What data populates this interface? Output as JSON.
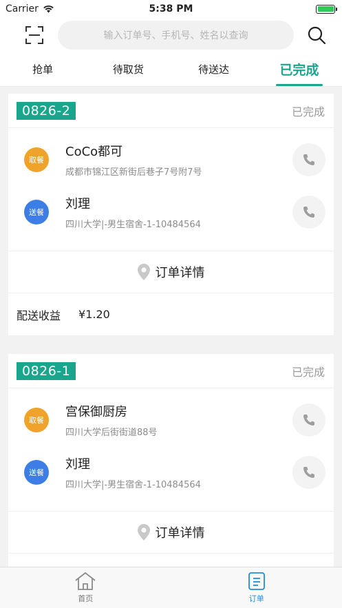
{
  "status_bar": {
    "carrier": "Carrier",
    "time": "5:38 PM"
  },
  "search": {
    "placeholder": "输入订单号、手机号、姓名以查询"
  },
  "tabs": [
    {
      "label": "抢单",
      "active": false
    },
    {
      "label": "待取货",
      "active": false
    },
    {
      "label": "待送达",
      "active": false
    },
    {
      "label": "已完成",
      "active": true
    }
  ],
  "orders": [
    {
      "order_no": "0826-2",
      "status": "已完成",
      "pickup": {
        "badge": "取餐",
        "name": "CoCo都可",
        "address": "成都市锦江区新街后巷子7号附7号"
      },
      "delivery": {
        "badge": "送餐",
        "name": "刘理",
        "address": "四川大学|-男生宿舍-1-10484564"
      },
      "detail_label": "订单详情",
      "income_label": "配送收益",
      "income_value": "¥1.20"
    },
    {
      "order_no": "0826-1",
      "status": "已完成",
      "pickup": {
        "badge": "取餐",
        "name": "宫保御厨房",
        "address": "四川大学后街街道88号"
      },
      "delivery": {
        "badge": "送餐",
        "name": "刘理",
        "address": "四川大学|-男生宿舍-1-10484564"
      },
      "detail_label": "订单详情"
    }
  ],
  "bottom_nav": [
    {
      "label": "首页",
      "icon": "home-icon",
      "active": false
    },
    {
      "label": "订单",
      "icon": "order-list-icon",
      "active": true
    }
  ],
  "colors": {
    "accent": "#1aa68c",
    "pickup": "#f0a32a",
    "delivery": "#3d7ee6",
    "nav_active": "#1d8fe0"
  }
}
